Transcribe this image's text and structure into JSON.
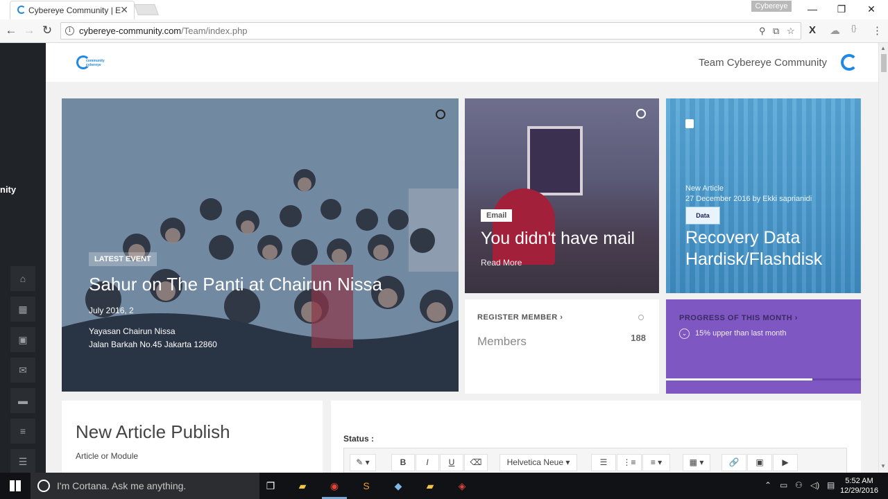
{
  "browser": {
    "tab_title": "Cybereye Community | E",
    "tab_close": "✕",
    "profile_name": "Cybereye",
    "minimize": "—",
    "restore": "❐",
    "close": "✕",
    "back": "←",
    "forward": "→",
    "reload": "↻",
    "url_domain": "cybereye-community.com",
    "url_path": "/Team/index.php",
    "info_icon": "i"
  },
  "sidebar": {
    "brand_fragment": "nity",
    "items": [
      {
        "icon": "home-icon",
        "glyph": "⌂"
      },
      {
        "icon": "calendar-icon",
        "glyph": "▦"
      },
      {
        "icon": "image-icon",
        "glyph": "▣"
      },
      {
        "icon": "mail-icon",
        "glyph": "✉"
      },
      {
        "icon": "chat-icon",
        "glyph": "▬"
      },
      {
        "icon": "menu-icon",
        "glyph": "≡"
      },
      {
        "icon": "list-icon",
        "glyph": "☰"
      }
    ]
  },
  "header": {
    "logo_line1": "community",
    "logo_line2": "cybereye",
    "title": "Team Cybereye Community"
  },
  "event_card": {
    "badge": "LATEST EVENT",
    "title": "Sahur on The Panti at Chairun Nissa",
    "date": "July 2016, 2",
    "place_line1": "Yayasan Chairun Nissa",
    "place_line2": "Jalan Barkah No.45 Jakarta 12860"
  },
  "mail_card": {
    "badge": "Email",
    "title": "You didn't have mail",
    "link": "Read More"
  },
  "article_card": {
    "kicker": "New Article",
    "meta": "27 December 2016 by Ekki saprianidi",
    "data_label": "Data",
    "title_line1": "Recovery Data",
    "title_line2": "Hardisk/Flashdisk"
  },
  "register_card": {
    "label": "REGISTER MEMBER ›",
    "subtitle": "Members",
    "count": "188"
  },
  "progress_card": {
    "label": "PROGRESS OF THIS MONTH ›",
    "text": "15% upper than last month",
    "progress_fraction": 0.75
  },
  "article_panel": {
    "title": "New Article Publish",
    "subtitle": "Article or Module"
  },
  "editor_panel": {
    "status_label": "Status :",
    "font_name": "Helvetica Neue ▾",
    "tools": [
      "✎ ▾",
      "B",
      "I",
      "U",
      "⌫",
      "☰",
      "⋮≡",
      "≡ ▾",
      "▦ ▾",
      "🔗",
      "▣",
      "▶"
    ]
  },
  "taskbar": {
    "cortana_placeholder": "I'm Cortana. Ask me anything.",
    "time": "5:52 AM",
    "date": "12/29/2016"
  },
  "colors": {
    "accent_blue": "#1e88e5",
    "progress_purple": "#7e57c2",
    "sidebar_dark": "#202327"
  }
}
